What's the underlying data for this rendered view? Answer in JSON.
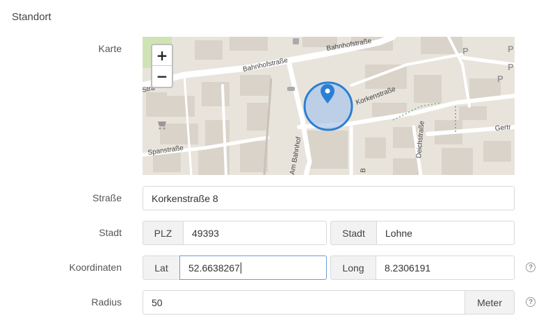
{
  "section": {
    "title": "Standort"
  },
  "map": {
    "label": "Karte",
    "zoom_in": "+",
    "zoom_out": "−",
    "streets": [
      "Bahnhofstraße",
      "Bahnhofstraße",
      "Korkenstraße",
      "Spanstraße",
      "Am Bahnhof",
      "Deichstraße",
      "Gertr",
      "Stra",
      "B"
    ],
    "parking_label": "P"
  },
  "street": {
    "label": "Straße",
    "value": "Korkenstraße 8"
  },
  "city": {
    "label": "Stadt",
    "plz_addon": "PLZ",
    "plz_value": "49393",
    "city_addon": "Stadt",
    "city_value": "Lohne"
  },
  "coordinates": {
    "label": "Koordinaten",
    "lat_addon": "Lat",
    "lat_value": "52.6638267",
    "long_addon": "Long",
    "long_value": "8.2306191",
    "help": "?"
  },
  "radius": {
    "label": "Radius",
    "value": "50",
    "unit_addon": "Meter",
    "help": "?"
  },
  "colors": {
    "marker": "#2a7fd4",
    "radius_fill": "#a9c6ea",
    "focus_border": "#6a9bd8"
  }
}
